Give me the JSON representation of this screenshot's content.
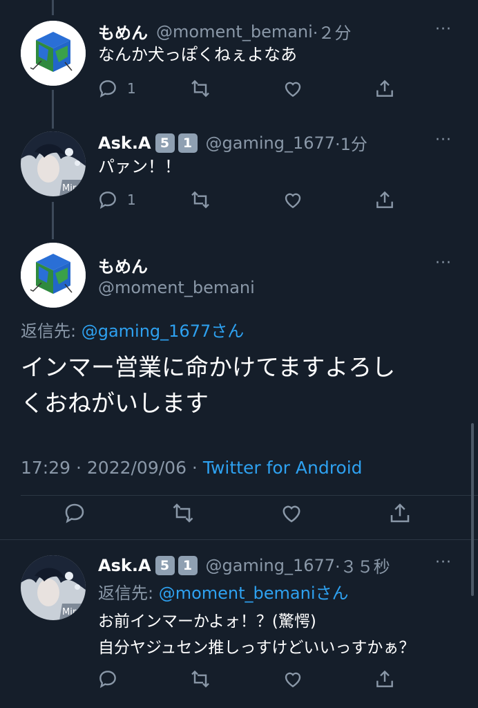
{
  "colors": {
    "background": "#151e2a",
    "muted": "#8a98a8",
    "link": "#2ea1f0",
    "text": "#ffffff"
  },
  "tweets": [
    {
      "name": "もめん",
      "handle": "@moment_bemani",
      "time": "·２分",
      "text": "なんか犬っぽくねぇよなあ",
      "reply_count": "1",
      "avatar": "cube-avatar"
    },
    {
      "name": "Ask.A",
      "badges": [
        "5",
        "1"
      ],
      "handle": "@gaming_1677",
      "time": "·1分",
      "text": "パァン！！",
      "reply_count": "1",
      "avatar": "anime-avatar"
    }
  ],
  "focused": {
    "name": "もめん",
    "handle": "@moment_bemani",
    "reply_label": "返信先: ",
    "reply_to": "@gaming_1677",
    "reply_suffix": "さん",
    "text_line1": "インマー営業に命かけてますよろし",
    "text_line2": "くおねがいします",
    "timestamp": "17:29 · 2022/09/06 · ",
    "source": "Twitter for Android"
  },
  "reply": {
    "name": "Ask.A",
    "badges": [
      "5",
      "1"
    ],
    "handle": "@gaming_1677",
    "time": "·３５秒",
    "reply_label": "返信先: ",
    "reply_to": "@moment_bemani",
    "reply_suffix": "さん",
    "text_line1": "お前インマーかよォ！？(驚愕)",
    "text_line2": "自分ヤジュセン推しっすけどいいっすかぁ？",
    "avatar": "anime-avatar"
  },
  "more_icon": "···"
}
